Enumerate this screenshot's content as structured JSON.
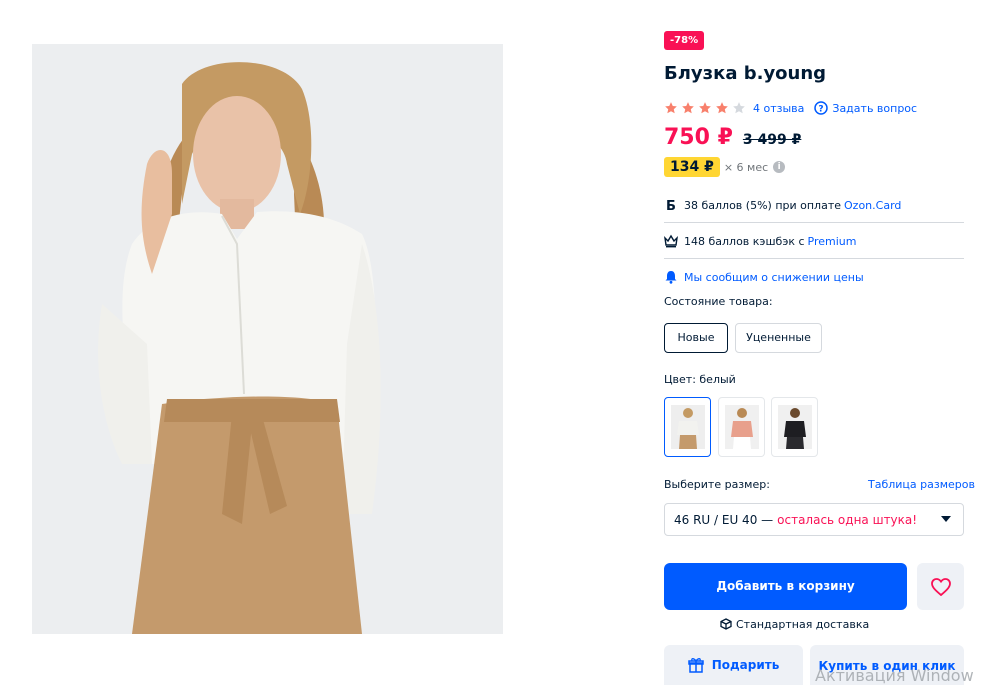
{
  "product": {
    "discount_badge": "-78%",
    "title": "Блузка b.young",
    "rating": {
      "stars": 4,
      "max": 5
    },
    "reviews_link": "4 отзыва",
    "ask_link": "Задать вопрос",
    "price_now": "750 ₽",
    "price_old": "3 499 ₽",
    "installment_price": "134 ₽",
    "installment_term": "× 6 мес",
    "info_icon": "i"
  },
  "benefits": {
    "ozon_card_text": "38 баллов (5%) при оплате ",
    "ozon_card_link": "Ozon.Card",
    "premium_text": "148 баллов кэшбэк с ",
    "premium_link": "Premium",
    "price_alert": "Мы сообщим о снижении цены",
    "card_glyph": "Б"
  },
  "condition": {
    "label": "Состояние товара:",
    "options": [
      "Новые",
      "Уцененные"
    ],
    "selected": "Новые"
  },
  "color": {
    "label": "Цвет: белый",
    "swatches": [
      {
        "name": "белый",
        "shirt": "#f2f2ef",
        "pants": "#c49a6c"
      },
      {
        "name": "розовый",
        "shirt": "#e8a08c",
        "pants": "#ffffff"
      },
      {
        "name": "черный",
        "shirt": "#1e1e22",
        "pants": "#2a2a2e"
      }
    ]
  },
  "size": {
    "label": "Выберите размер:",
    "table_link": "Таблица размеров",
    "selected": "46 RU / EU 40 —",
    "warning": "осталась одна штука!"
  },
  "actions": {
    "add_to_cart": "Добавить в корзину",
    "delivery": "Стандартная доставка",
    "gift": "Подарить",
    "buy_one_click": "Купить в один клик"
  },
  "overlay": {
    "activation": "Активация Window"
  },
  "colors": {
    "accent": "#005bff",
    "sale": "#f91155",
    "star_active": "#f8806c",
    "star_inactive": "#d5d9de",
    "installment": "#ffd633"
  }
}
